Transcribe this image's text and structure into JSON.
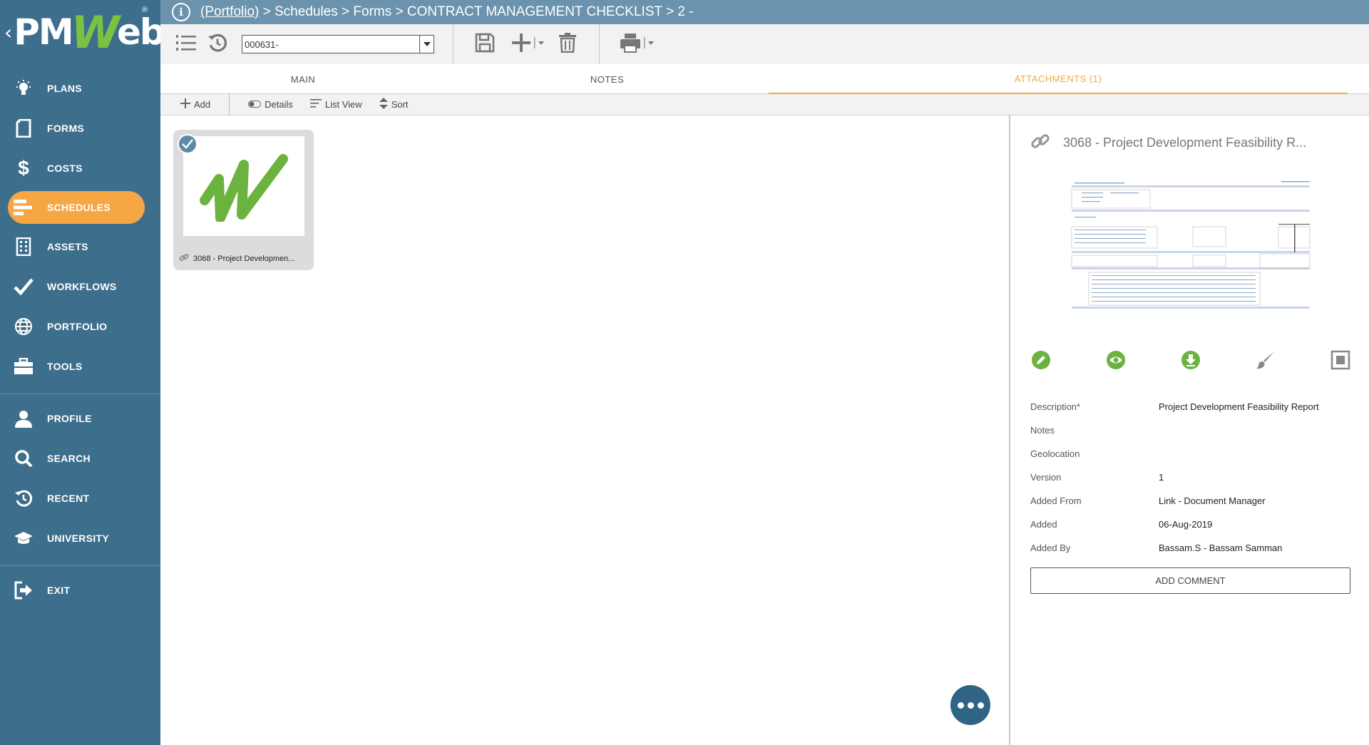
{
  "logo": {
    "text_pm": "PM",
    "text_w": "W",
    "text_eb": "eb",
    "registered": "®"
  },
  "sidebar": {
    "groups": [
      [
        {
          "label": "PLANS",
          "icon": "lightbulb-icon"
        },
        {
          "label": "FORMS",
          "icon": "document-icon"
        },
        {
          "label": "COSTS",
          "icon": "dollar-icon"
        },
        {
          "label": "SCHEDULES",
          "icon": "schedule-bars-icon",
          "active": true
        },
        {
          "label": "ASSETS",
          "icon": "building-icon"
        },
        {
          "label": "WORKFLOWS",
          "icon": "checkmark-icon"
        },
        {
          "label": "PORTFOLIO",
          "icon": "globe-icon"
        },
        {
          "label": "TOOLS",
          "icon": "briefcase-icon"
        }
      ],
      [
        {
          "label": "PROFILE",
          "icon": "person-icon"
        },
        {
          "label": "SEARCH",
          "icon": "search-icon"
        },
        {
          "label": "RECENT",
          "icon": "history-icon"
        },
        {
          "label": "UNIVERSITY",
          "icon": "graduation-cap-icon"
        }
      ],
      [
        {
          "label": "EXIT",
          "icon": "exit-icon"
        }
      ]
    ]
  },
  "breadcrumb": {
    "portfolio": "(Portfolio)",
    "rest": " > Schedules > Forms > CONTRACT MANAGEMENT CHECKLIST > 2 -"
  },
  "toolbar": {
    "record_value": "000631-"
  },
  "tabs": [
    {
      "label": "MAIN"
    },
    {
      "label": "NOTES"
    },
    {
      "label": "ATTACHMENTS (1)",
      "active": true
    }
  ],
  "subbar": {
    "add": "Add",
    "details": "Details",
    "list_view": "List View",
    "sort": "Sort"
  },
  "attachment_card": {
    "caption": "3068 - Project Developmen..."
  },
  "panel": {
    "title": "3068 - Project Development Feasibility R...",
    "properties": [
      {
        "label": "Description*",
        "value": "Project Development Feasibility Report"
      },
      {
        "label": "Notes",
        "value": ""
      },
      {
        "label": "Geolocation",
        "value": ""
      },
      {
        "label": "Version",
        "value": "1"
      },
      {
        "label": "Added From",
        "value": "Link - Document Manager"
      },
      {
        "label": "Added",
        "value": "06-Aug-2019"
      },
      {
        "label": "Added By",
        "value": "Bassam.S - Bassam Samman"
      }
    ],
    "add_comment": "ADD COMMENT"
  },
  "colors": {
    "sidebar": "#3d6e8c",
    "topbar": "#6b93ad",
    "accent": "#f7a644",
    "green": "#7cc242"
  }
}
